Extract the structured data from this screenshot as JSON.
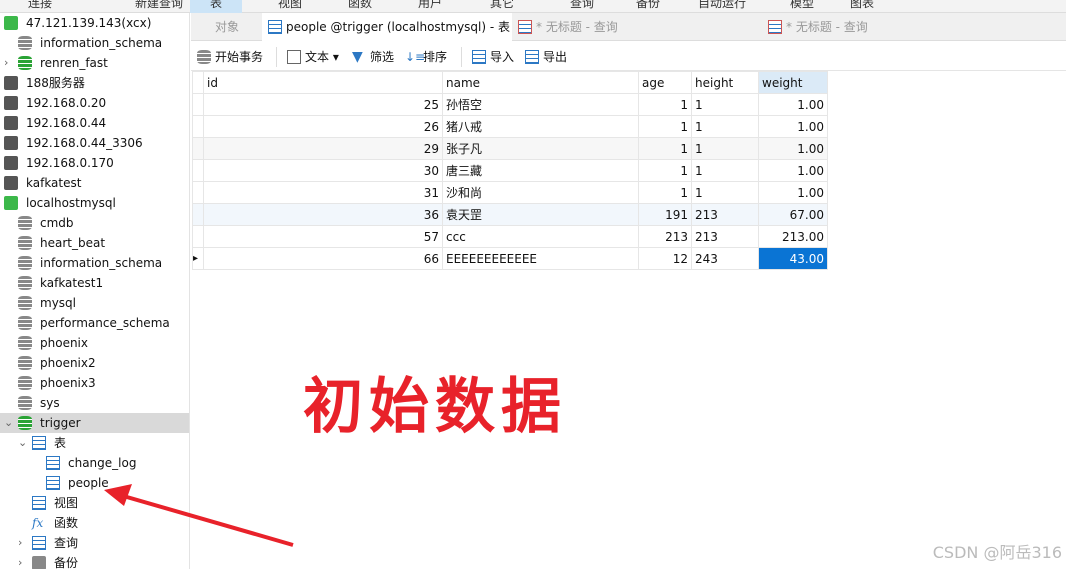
{
  "menu": [
    "连接",
    "新建查询",
    "表",
    "视图",
    "函数",
    "用户",
    "其它",
    "查询",
    "备份",
    "自动运行",
    "模型",
    "图表"
  ],
  "sidebar": {
    "items": [
      {
        "label": "47.121.139.143(xcx)",
        "icon": "connection-icon",
        "level": 0
      },
      {
        "label": "information_schema",
        "icon": "database-icon",
        "level": 1
      },
      {
        "label": "renren_fast",
        "icon": "database-icon-green",
        "level": 1,
        "chev": "›"
      },
      {
        "label": "188服务器",
        "icon": "connection-icon-gray",
        "level": 0
      },
      {
        "label": "192.168.0.20",
        "icon": "connection-icon-gray",
        "level": 0
      },
      {
        "label": "192.168.0.44",
        "icon": "connection-icon-gray",
        "level": 0
      },
      {
        "label": "192.168.0.44_3306",
        "icon": "connection-icon-gray",
        "level": 0
      },
      {
        "label": "192.168.0.170",
        "icon": "connection-icon-gray",
        "level": 0
      },
      {
        "label": "kafkatest",
        "icon": "connection-icon-gray",
        "level": 0
      },
      {
        "label": "localhostmysql",
        "icon": "connection-icon",
        "level": 0
      },
      {
        "label": "cmdb",
        "icon": "database-icon",
        "level": 1
      },
      {
        "label": "heart_beat",
        "icon": "database-icon",
        "level": 1
      },
      {
        "label": "information_schema",
        "icon": "database-icon",
        "level": 1
      },
      {
        "label": "kafkatest1",
        "icon": "database-icon",
        "level": 1
      },
      {
        "label": "mysql",
        "icon": "database-icon",
        "level": 1
      },
      {
        "label": "performance_schema",
        "icon": "database-icon",
        "level": 1
      },
      {
        "label": "phoenix",
        "icon": "database-icon",
        "level": 1
      },
      {
        "label": "phoenix2",
        "icon": "database-icon",
        "level": 1
      },
      {
        "label": "phoenix3",
        "icon": "database-icon",
        "level": 1
      },
      {
        "label": "sys",
        "icon": "database-icon",
        "level": 1
      },
      {
        "label": "trigger",
        "icon": "database-icon-green",
        "level": 1,
        "chev": "⌄",
        "selected": true
      },
      {
        "label": "表",
        "icon": "table-icon",
        "level": 2,
        "chev": "⌄"
      },
      {
        "label": "change_log",
        "icon": "table-icon",
        "level": 3
      },
      {
        "label": "people",
        "icon": "table-icon",
        "level": 3
      },
      {
        "label": "视图",
        "icon": "view-icon",
        "level": 2
      },
      {
        "label": "函数",
        "icon": "function-icon",
        "level": 2
      },
      {
        "label": "查询",
        "icon": "query-icon",
        "level": 2,
        "chev": "›"
      },
      {
        "label": "备份",
        "icon": "backup-icon",
        "level": 2,
        "chev": "›"
      }
    ]
  },
  "tabs": [
    {
      "label": "对象",
      "active": false
    },
    {
      "label": "people @trigger (localhostmysql) - 表",
      "active": true
    },
    {
      "label": "* 无标题 - 查询",
      "active": false
    },
    {
      "label": "* 无标题 - 查询",
      "active": false
    }
  ],
  "toolbar": {
    "begin_transaction": "开始事务",
    "text": "文本",
    "filter": "筛选",
    "sort": "排序",
    "import": "导入",
    "export": "导出"
  },
  "grid": {
    "columns": [
      "id",
      "name",
      "age",
      "height",
      "weight"
    ],
    "rows": [
      [
        "25",
        "孙悟空",
        "1",
        "1",
        "1.00"
      ],
      [
        "26",
        "猪八戒",
        "1",
        "1",
        "1.00"
      ],
      [
        "29",
        "张子凡",
        "1",
        "1",
        "1.00"
      ],
      [
        "30",
        "唐三藏",
        "1",
        "1",
        "1.00"
      ],
      [
        "31",
        "沙和尚",
        "1",
        "1",
        "1.00"
      ],
      [
        "36",
        "袁天罡",
        "191",
        "213",
        "67.00"
      ],
      [
        "57",
        "ccc",
        "213",
        "213",
        "213.00"
      ],
      [
        "66",
        "EEEEEEEEEEEE",
        "12",
        "243",
        "43.00"
      ]
    ]
  },
  "annotation": "初始数据",
  "watermark": "CSDN @阿岳316",
  "colors": {
    "accent": "#0a74d4",
    "annotation": "#e8222a",
    "db_green": "#2aa335"
  }
}
